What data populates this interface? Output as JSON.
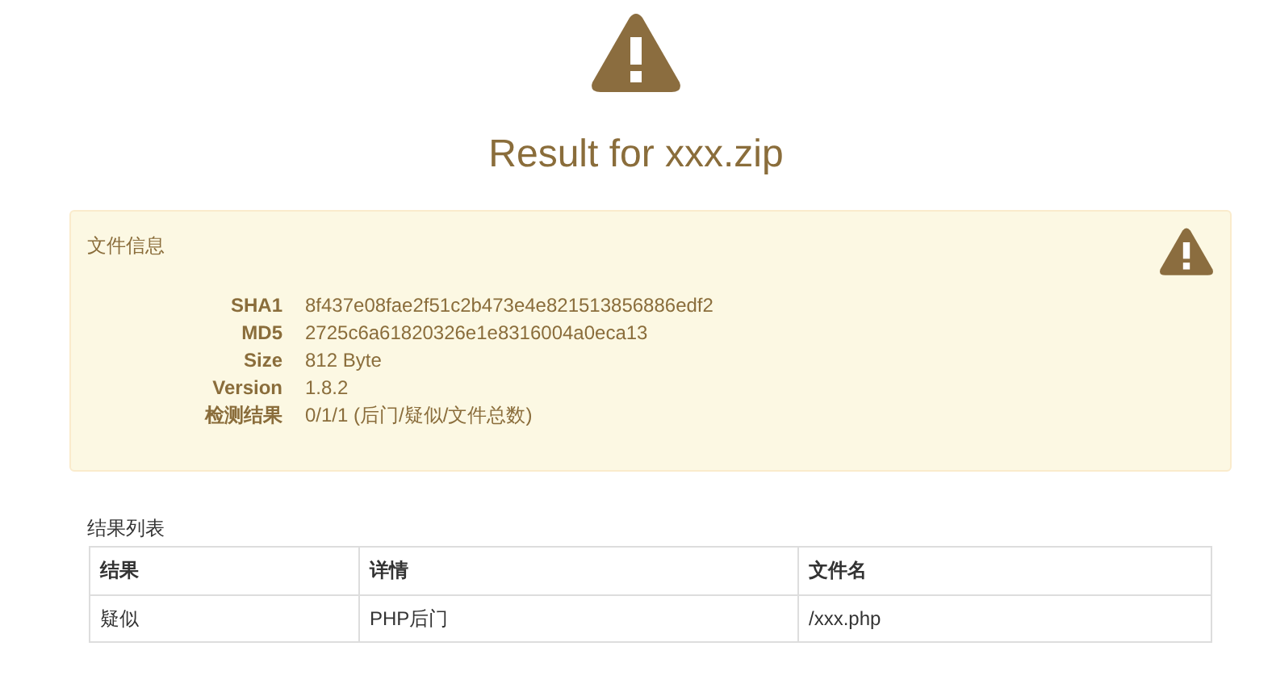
{
  "title": "Result for xxx.zip",
  "panel": {
    "heading": "文件信息",
    "fields": [
      {
        "label": "SHA1",
        "value": "8f437e08fae2f51c2b473e4e821513856886edf2"
      },
      {
        "label": "MD5",
        "value": "2725c6a61820326e1e8316004a0eca13"
      },
      {
        "label": "Size",
        "value": "812 Byte"
      },
      {
        "label": "Version",
        "value": "1.8.2"
      },
      {
        "label": "检测结果",
        "value": "0/1/1 (后门/疑似/文件总数)"
      }
    ]
  },
  "results": {
    "caption": "结果列表",
    "columns": [
      "结果",
      "详情",
      "文件名"
    ],
    "rows": [
      [
        "疑似",
        "PHP后门",
        "/xxx.php"
      ]
    ]
  }
}
